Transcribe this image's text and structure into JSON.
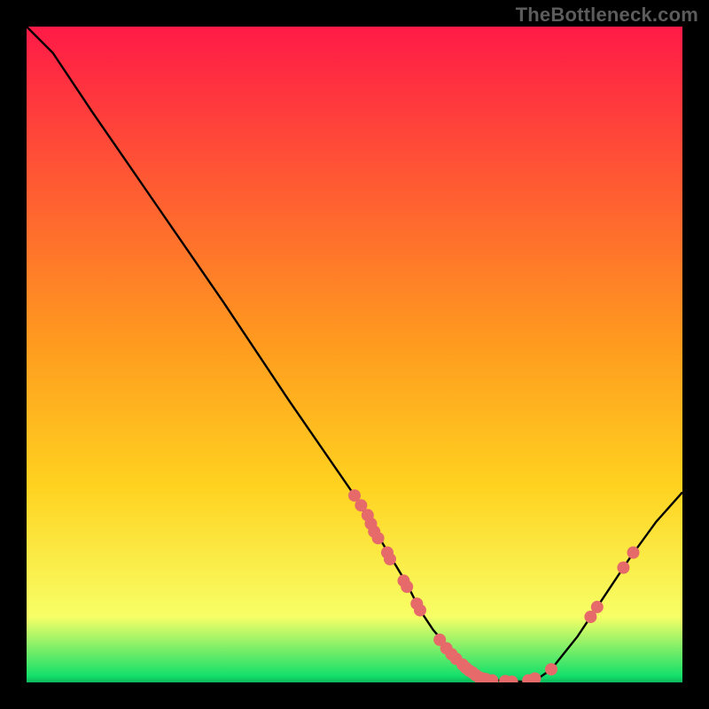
{
  "attribution": "TheBottleneck.com",
  "colors": {
    "gradient_top": "#ff1a47",
    "gradient_mid": "#ffd21f",
    "gradient_low": "#f7ff66",
    "gradient_bottom": "#14e06b",
    "curve": "#000000",
    "dot": "#e76a6a"
  },
  "chart_data": {
    "type": "line",
    "title": "",
    "xlabel": "",
    "ylabel": "",
    "xlim": [
      0,
      100
    ],
    "ylim": [
      0,
      100
    ],
    "series": [
      {
        "name": "bottleneck-curve",
        "x": [
          0,
          4,
          10,
          20,
          30,
          40,
          50,
          55,
          58,
          60,
          62,
          65,
          68,
          72,
          76,
          78,
          80,
          84,
          88,
          92,
          96,
          100
        ],
        "y": [
          100,
          96,
          87,
          72.5,
          58,
          43,
          28.5,
          20,
          15,
          11,
          8,
          4.5,
          2,
          0.3,
          0.1,
          0.6,
          2,
          7,
          13,
          19,
          24.5,
          29
        ]
      }
    ],
    "scatter": {
      "name": "data-points",
      "points": [
        {
          "x": 50,
          "y": 28.5
        },
        {
          "x": 51,
          "y": 27
        },
        {
          "x": 52,
          "y": 25.5
        },
        {
          "x": 52.5,
          "y": 24.2
        },
        {
          "x": 53,
          "y": 23
        },
        {
          "x": 53.6,
          "y": 22
        },
        {
          "x": 55,
          "y": 19.8
        },
        {
          "x": 55.4,
          "y": 18.8
        },
        {
          "x": 57.5,
          "y": 15.5
        },
        {
          "x": 58,
          "y": 14.6
        },
        {
          "x": 59.5,
          "y": 12
        },
        {
          "x": 60,
          "y": 11
        },
        {
          "x": 63,
          "y": 6.5
        },
        {
          "x": 64,
          "y": 5.2
        },
        {
          "x": 64.8,
          "y": 4.3
        },
        {
          "x": 65.5,
          "y": 3.6
        },
        {
          "x": 66.5,
          "y": 2.7
        },
        {
          "x": 67,
          "y": 2.2
        },
        {
          "x": 67.5,
          "y": 1.8
        },
        {
          "x": 68,
          "y": 1.5
        },
        {
          "x": 68.5,
          "y": 1.1
        },
        {
          "x": 69,
          "y": 0.8
        },
        {
          "x": 69.5,
          "y": 0.6
        },
        {
          "x": 70,
          "y": 0.5
        },
        {
          "x": 71,
          "y": 0.3
        },
        {
          "x": 73,
          "y": 0.2
        },
        {
          "x": 74,
          "y": 0.1
        },
        {
          "x": 76.5,
          "y": 0.3
        },
        {
          "x": 77.5,
          "y": 0.6
        },
        {
          "x": 80,
          "y": 2.0
        },
        {
          "x": 86,
          "y": 10.0
        },
        {
          "x": 87,
          "y": 11.5
        },
        {
          "x": 91,
          "y": 17.5
        },
        {
          "x": 92.5,
          "y": 19.8
        }
      ]
    }
  }
}
